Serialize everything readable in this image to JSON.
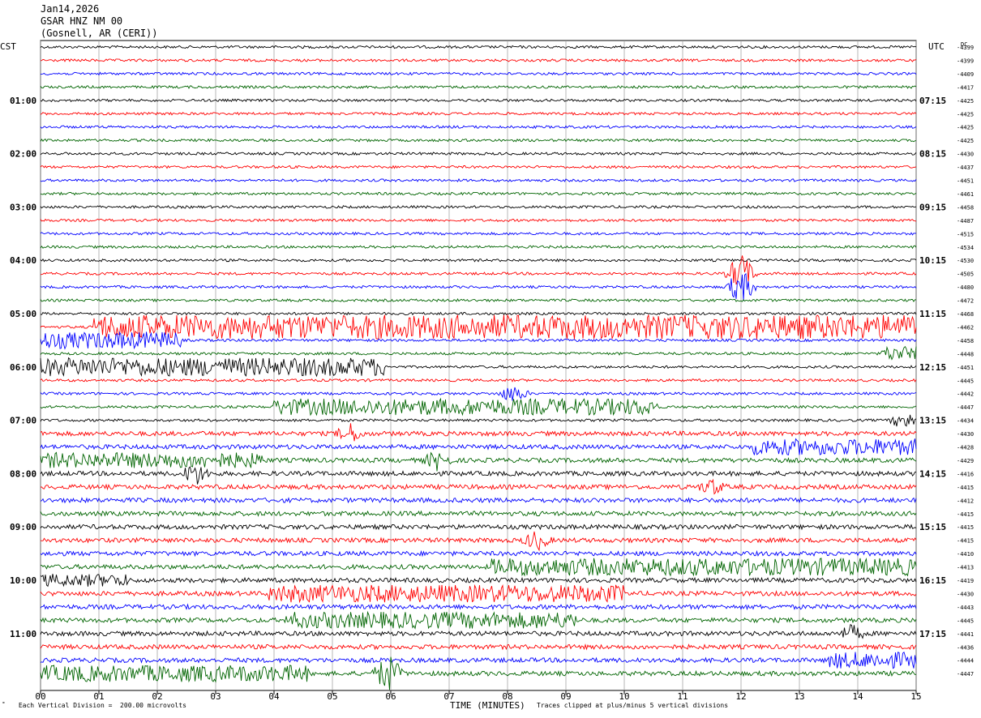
{
  "header": {
    "date": "Jan14,2026",
    "station": "GSAR HNZ NM 00",
    "location": "(Gosnell, AR (CERI))"
  },
  "chart_data": {
    "type": "seismogram",
    "left_axis_label": "CST",
    "right_axis_label": "UTC",
    "dc_label": "DC",
    "xlabel": "TIME (MINUTES)",
    "x_ticks": [
      "00",
      "01",
      "02",
      "03",
      "04",
      "05",
      "06",
      "07",
      "08",
      "09",
      "10",
      "11",
      "12",
      "13",
      "14",
      "15"
    ],
    "xlim": [
      0,
      15
    ],
    "colors": [
      "#000000",
      "#ff0000",
      "#0000ff",
      "#006400"
    ],
    "cst_labels": [
      "01:00",
      "02:00",
      "03:00",
      "04:00",
      "05:00",
      "06:00",
      "07:00",
      "08:00",
      "09:00",
      "10:00",
      "11:00"
    ],
    "utc_labels": [
      "07:15",
      "08:15",
      "09:15",
      "10:15",
      "11:15",
      "12:15",
      "13:15",
      "14:15",
      "15:15",
      "16:15",
      "17:15"
    ],
    "dc_offsets": [
      "-4399",
      "-4399",
      "-4409",
      "-4417",
      "-4425",
      "-4425",
      "-4425",
      "-4425",
      "-4430",
      "-4437",
      "-4451",
      "-4461",
      "-4458",
      "-4487",
      "-4515",
      "-4534",
      "-4530",
      "-4505",
      "-4480",
      "-4472",
      "-4468",
      "-4462",
      "-4458",
      "-4448",
      "-4451",
      "-4445",
      "-4442",
      "-4447",
      "-4434",
      "-4430",
      "-4428",
      "-4429",
      "-4416",
      "-4415",
      "-4412",
      "-4415",
      "-4415",
      "-4415",
      "-4410",
      "-4413",
      "-4419",
      "-4430",
      "-4443",
      "-4445",
      "-4441",
      "-4436",
      "-4444",
      "-4447"
    ],
    "trace_count": 48,
    "bursts": [
      {
        "trace": 21,
        "x0": 0.9,
        "x1": 15,
        "amp": 5.0
      },
      {
        "trace": 22,
        "x0": 0.0,
        "x1": 2.4,
        "amp": 3.5
      },
      {
        "trace": 23,
        "x0": 14.4,
        "x1": 15,
        "amp": 3.0
      },
      {
        "trace": 24,
        "x0": 0.0,
        "x1": 5.9,
        "amp": 3.8
      },
      {
        "trace": 27,
        "x0": 4.0,
        "x1": 10.6,
        "amp": 3.4
      },
      {
        "trace": 30,
        "x0": 12.2,
        "x1": 15,
        "amp": 3.4
      },
      {
        "trace": 31,
        "x0": 0.0,
        "x1": 3.8,
        "amp": 3.2
      },
      {
        "trace": 39,
        "x0": 7.7,
        "x1": 15,
        "amp": 3.6
      },
      {
        "trace": 40,
        "x0": 0.0,
        "x1": 1.5,
        "amp": 2.6
      },
      {
        "trace": 41,
        "x0": 3.9,
        "x1": 10.0,
        "amp": 3.6
      },
      {
        "trace": 43,
        "x0": 4.2,
        "x1": 9.2,
        "amp": 3.4
      },
      {
        "trace": 46,
        "x0": 13.5,
        "x1": 15,
        "amp": 3.4
      },
      {
        "trace": 47,
        "x0": 0.0,
        "x1": 4.6,
        "amp": 3.4
      }
    ],
    "spikes": [
      {
        "trace": 17,
        "x": 12.0,
        "amp": 6.0
      },
      {
        "trace": 18,
        "x": 12.0,
        "amp": 5.0
      },
      {
        "trace": 26,
        "x": 8.1,
        "amp": 2.5
      },
      {
        "trace": 29,
        "x": 5.3,
        "amp": 3.0
      },
      {
        "trace": 31,
        "x": 6.8,
        "amp": 3.0
      },
      {
        "trace": 32,
        "x": 2.65,
        "amp": 3.5
      },
      {
        "trace": 33,
        "x": 11.5,
        "amp": 2.5
      },
      {
        "trace": 37,
        "x": 8.5,
        "amp": 3.0
      },
      {
        "trace": 44,
        "x": 13.9,
        "amp": 2.5
      },
      {
        "trace": 47,
        "x": 5.95,
        "amp": 6.0
      },
      {
        "trace": 28,
        "x": 14.8,
        "amp": 2.5
      }
    ]
  },
  "footer": {
    "left_note": "Each Vertical Division =  200.00 microvolts",
    "right_note": "Traces clipped at plus/minus 5 vertical divisions"
  }
}
